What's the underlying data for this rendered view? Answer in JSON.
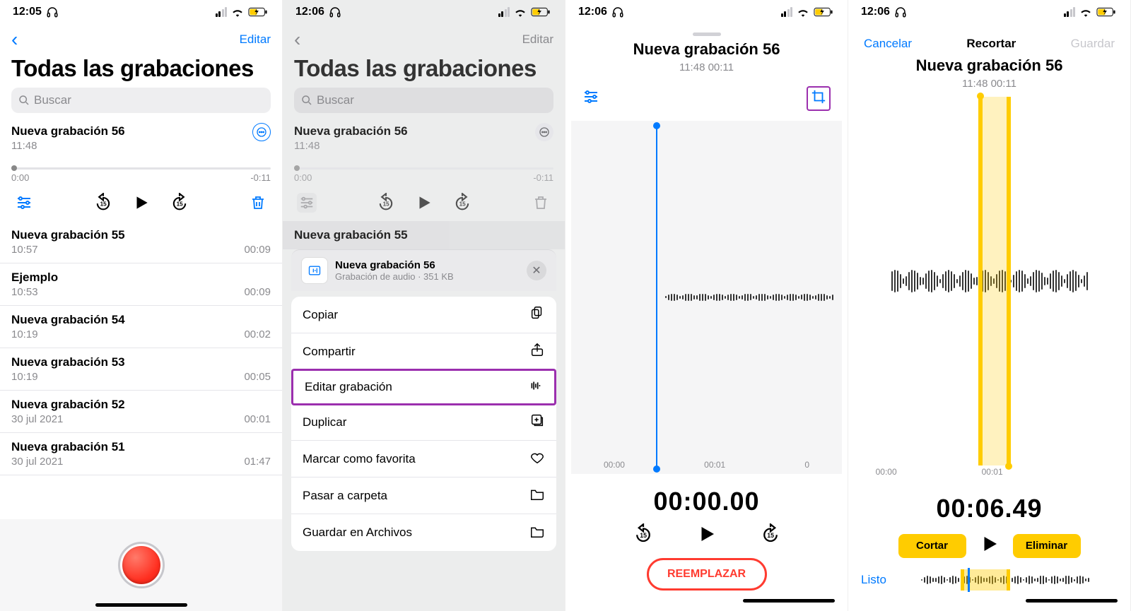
{
  "status_times": [
    "12:05",
    "12:06",
    "12:06",
    "12:06"
  ],
  "signal_bars_on": 2,
  "s1": {
    "edit_link": "Editar",
    "title": "Todas las grabaciones",
    "search_ph": "Buscar",
    "selected": {
      "title": "Nueva grabación 56",
      "time": "11:48",
      "t0": "0:00",
      "t1": "-0:11"
    },
    "rows": [
      {
        "title": "Nueva grabación 55",
        "sub": "10:57",
        "dur": "00:09"
      },
      {
        "title": "Ejemplo",
        "sub": "10:53",
        "dur": "00:09"
      },
      {
        "title": "Nueva grabación 54",
        "sub": "10:19",
        "dur": "00:02"
      },
      {
        "title": "Nueva grabación 53",
        "sub": "10:19",
        "dur": "00:05"
      },
      {
        "title": "Nueva grabación 52",
        "sub": "30 jul 2021",
        "dur": "00:01"
      },
      {
        "title": "Nueva grabación 51",
        "sub": "30 jul 2021",
        "dur": "01:47"
      }
    ]
  },
  "s2": {
    "edit_link": "Editar",
    "title": "Todas las grabaciones",
    "search_ph": "Buscar",
    "selected": {
      "title": "Nueva grabación 56",
      "time": "11:48",
      "t0": "0:00",
      "t1": "-0:11"
    },
    "row2": "Nueva grabación 55",
    "sheet_title": "Nueva grabación 56",
    "sheet_sub": "Grabación de audio · 351 KB",
    "actions": [
      "Copiar",
      "Compartir",
      "Editar grabación",
      "Duplicar",
      "Marcar como favorita",
      "Pasar a carpeta",
      "Guardar en Archivos"
    ],
    "highlight_index": 2
  },
  "s3": {
    "title": "Nueva grabación 56",
    "sub": "11:48  00:11",
    "ticks": [
      "00:00",
      "00:01",
      "0"
    ],
    "big": "00:00.00",
    "replace": "REEMPLAZAR"
  },
  "s4": {
    "cancel": "Cancelar",
    "mid": "Recortar",
    "save": "Guardar",
    "title": "Nueva grabación 56",
    "sub": "11:48  00:11",
    "ticks": [
      "00:00",
      "00:01"
    ],
    "big": "00:06.49",
    "cut": "Cortar",
    "del": "Eliminar",
    "done": "Listo"
  }
}
